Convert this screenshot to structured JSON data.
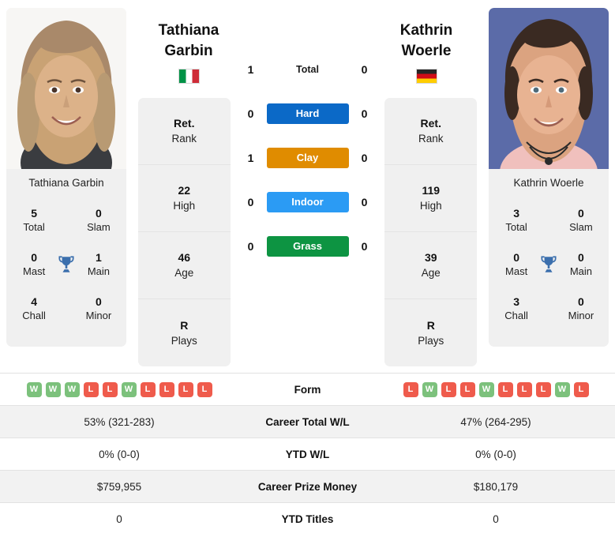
{
  "players": {
    "left": {
      "first_name": "Tathiana",
      "last_name": "Garbin",
      "full_name": "Tathiana Garbin",
      "country_code": "IT",
      "flag": "italy-flag",
      "photo_description": "portrait-tathiana-garbin",
      "titles": {
        "total": "5",
        "total_label": "Total",
        "slam": "0",
        "slam_label": "Slam",
        "mast": "0",
        "mast_label": "Mast",
        "main": "1",
        "main_label": "Main",
        "chall": "4",
        "chall_label": "Chall",
        "minor": "0",
        "minor_label": "Minor"
      },
      "info": [
        {
          "value": "Ret.",
          "label": "Rank"
        },
        {
          "value": "22",
          "label": "High"
        },
        {
          "value": "46",
          "label": "Age"
        },
        {
          "value": "R",
          "label": "Plays"
        }
      ],
      "form": [
        "W",
        "W",
        "W",
        "L",
        "L",
        "W",
        "L",
        "L",
        "L",
        "L"
      ],
      "career_total_wl": "53% (321-283)",
      "ytd_wl": "0% (0-0)",
      "career_prize_money": "$759,955",
      "ytd_titles": "0"
    },
    "right": {
      "first_name": "Kathrin",
      "last_name": "Woerle",
      "full_name": "Kathrin Woerle",
      "country_code": "DE",
      "flag": "germany-flag",
      "photo_description": "portrait-kathrin-woerle",
      "titles": {
        "total": "3",
        "total_label": "Total",
        "slam": "0",
        "slam_label": "Slam",
        "mast": "0",
        "mast_label": "Mast",
        "main": "0",
        "main_label": "Main",
        "chall": "3",
        "chall_label": "Chall",
        "minor": "0",
        "minor_label": "Minor"
      },
      "info": [
        {
          "value": "Ret.",
          "label": "Rank"
        },
        {
          "value": "119",
          "label": "High"
        },
        {
          "value": "39",
          "label": "Age"
        },
        {
          "value": "R",
          "label": "Plays"
        }
      ],
      "form": [
        "L",
        "W",
        "L",
        "L",
        "W",
        "L",
        "L",
        "L",
        "W",
        "L"
      ],
      "career_total_wl": "47% (264-295)",
      "ytd_wl": "0% (0-0)",
      "career_prize_money": "$180,179",
      "ytd_titles": "0"
    }
  },
  "head_to_head": [
    {
      "label": "Total",
      "left": "1",
      "right": "0",
      "type": "total",
      "color": ""
    },
    {
      "label": "Hard",
      "left": "0",
      "right": "0",
      "type": "surface",
      "color": "#0b69c7"
    },
    {
      "label": "Clay",
      "left": "1",
      "right": "0",
      "type": "surface",
      "color": "#e08c00"
    },
    {
      "label": "Indoor",
      "left": "0",
      "right": "0",
      "type": "surface",
      "color": "#2b9bf4"
    },
    {
      "label": "Grass",
      "left": "0",
      "right": "0",
      "type": "surface",
      "color": "#0d9442"
    }
  ],
  "table_rows": [
    {
      "label": "Form",
      "key": "form",
      "kind": "form"
    },
    {
      "label": "Career Total W/L",
      "key": "career_total_wl",
      "kind": "text"
    },
    {
      "label": "YTD W/L",
      "key": "ytd_wl",
      "kind": "text"
    },
    {
      "label": "Career Prize Money",
      "key": "career_prize_money",
      "kind": "text"
    },
    {
      "label": "YTD Titles",
      "key": "ytd_titles",
      "kind": "text"
    }
  ],
  "colors": {
    "hard": "#0b69c7",
    "clay": "#e08c00",
    "indoor": "#2b9bf4",
    "grass": "#0d9442",
    "win_badge": "#7cc17c",
    "loss_badge": "#ef5b4c",
    "card_bg": "#f0f0f0",
    "trophy": "#3b6fad"
  }
}
